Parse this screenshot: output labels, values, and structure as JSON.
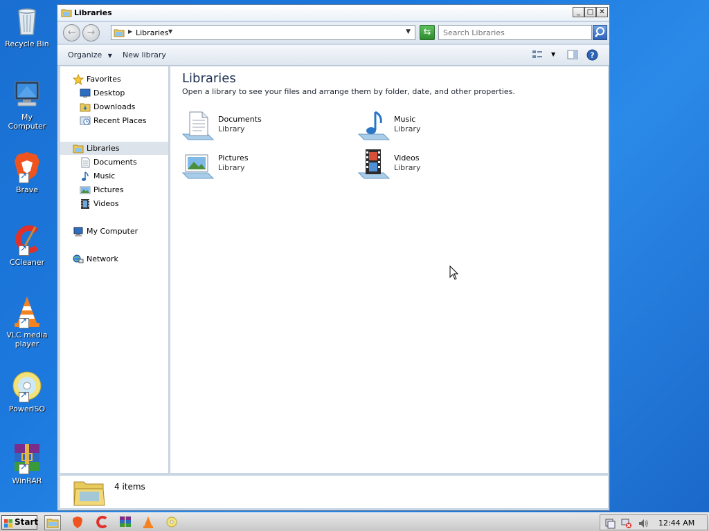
{
  "desktop": {
    "icons": [
      {
        "label": "Recycle Bin"
      },
      {
        "label": "My Computer"
      },
      {
        "label": "Brave"
      },
      {
        "label": "CCleaner"
      },
      {
        "label": "VLC media player"
      },
      {
        "label": "PowerISO"
      },
      {
        "label": "WinRAR"
      }
    ]
  },
  "window": {
    "title": "Libraries",
    "controls": {
      "minimize": "_",
      "maximize": "□",
      "close": "✕"
    },
    "address": {
      "path": "Libraries"
    },
    "search": {
      "placeholder": "Search Libraries"
    },
    "toolbar": {
      "organize": "Organize",
      "new_library": "New library"
    }
  },
  "navpane": {
    "favorites": "Favorites",
    "favorites_items": [
      "Desktop",
      "Downloads",
      "Recent Places"
    ],
    "libraries": "Libraries",
    "libraries_items": [
      "Documents",
      "Music",
      "Pictures",
      "Videos"
    ],
    "my_computer": "My Computer",
    "network": "Network"
  },
  "content": {
    "title": "Libraries",
    "subtitle": "Open a library to see your files and arrange them by folder, date, and other properties.",
    "libraries": [
      {
        "name": "Documents",
        "type": "Library"
      },
      {
        "name": "Music",
        "type": "Library"
      },
      {
        "name": "Pictures",
        "type": "Library"
      },
      {
        "name": "Videos",
        "type": "Library"
      }
    ]
  },
  "details": {
    "count": "4 items"
  },
  "taskbar": {
    "start": "Start",
    "clock": "12:44 AM"
  },
  "colors": {
    "accent": "#1c79de",
    "selection": "#dde3ea"
  }
}
